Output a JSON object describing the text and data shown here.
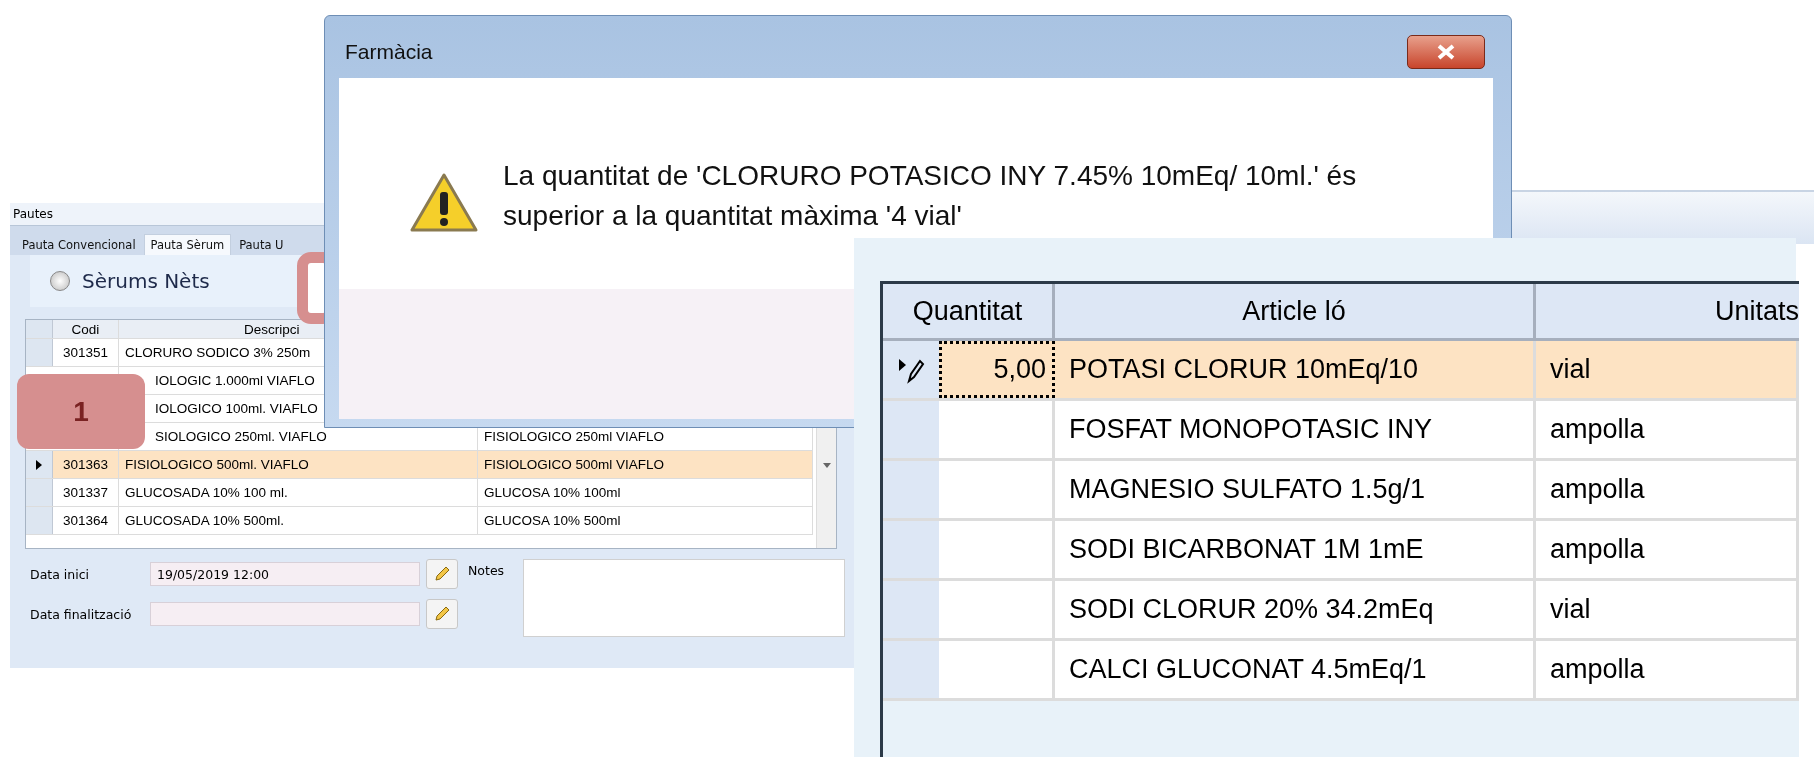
{
  "background_window": {
    "title": "Pautes",
    "tabs": [
      {
        "label": "Pauta Convencional",
        "selected": false
      },
      {
        "label": "Pauta Sèrum",
        "selected": true
      },
      {
        "label": "Pauta U",
        "selected": false
      }
    ],
    "radio": {
      "label": "Sèrums Nèts",
      "checked": false
    },
    "grid": {
      "columns": [
        "Codi",
        "Descripci"
      ],
      "rows": [
        {
          "code": "301351",
          "description": "CLORURO SODICO 3% 250m",
          "selected": false
        },
        {
          "description": "IOLOGIC 1.000ml VIAFLO",
          "selected": false
        },
        {
          "description": "IOLOGICO 100ml. VIAFLO",
          "selected": false
        },
        {
          "description": "SIOLOGICO 250ml. VIAFLO",
          "column_3": "FISIOLOGICO 250ml VIAFLO",
          "selected": false
        },
        {
          "code": "301363",
          "description": "FISIOLOGICO 500ml. VIAFLO",
          "column_3": "FISIOLOGICO 500ml VIAFLO",
          "selected": true
        },
        {
          "code": "301337",
          "description": "GLUCOSADA 10% 100 ml.",
          "column_3": "GLUCOSA 10% 100ml",
          "selected": false
        },
        {
          "code": "301364",
          "description": "GLUCOSADA 10% 500ml.",
          "column_3": "GLUCOSA 10% 500ml",
          "selected": false
        }
      ]
    },
    "form": {
      "start_label": "Data inici",
      "start_value": "19/05/2019 12:00",
      "end_label": "Data finalització",
      "notes_label": "Notes"
    }
  },
  "annotation_badge": {
    "label": "1"
  },
  "dialog": {
    "title": "Farmàcia",
    "message": "La quantitat de 'CLORURO POTASICO INY 7.45% 10mEq/ 10ml.' és superior a la quantitat màxima '4 vial'"
  },
  "product_window": {
    "columns": [
      "Quantitat",
      "Article ló",
      "Unitats"
    ],
    "rows": [
      {
        "quantity": "5,00",
        "article": "POTASI CLORUR 10mEq/10",
        "unit": "vial",
        "selected": true
      },
      {
        "article": "FOSFAT MONOPOTASIC INY",
        "unit": "ampolla",
        "selected": false
      },
      {
        "article": "MAGNESIO SULFATO 1.5g/1",
        "unit": "ampolla",
        "selected": false
      },
      {
        "article": "SODI BICARBONAT 1M 1mE",
        "unit": "ampolla",
        "selected": false
      },
      {
        "article": "SODI CLORUR 20% 34.2mEq",
        "unit": "vial",
        "selected": false
      },
      {
        "article": "CALCI GLUCONAT 4.5mEq/1",
        "unit": "ampolla",
        "selected": false
      }
    ]
  }
}
